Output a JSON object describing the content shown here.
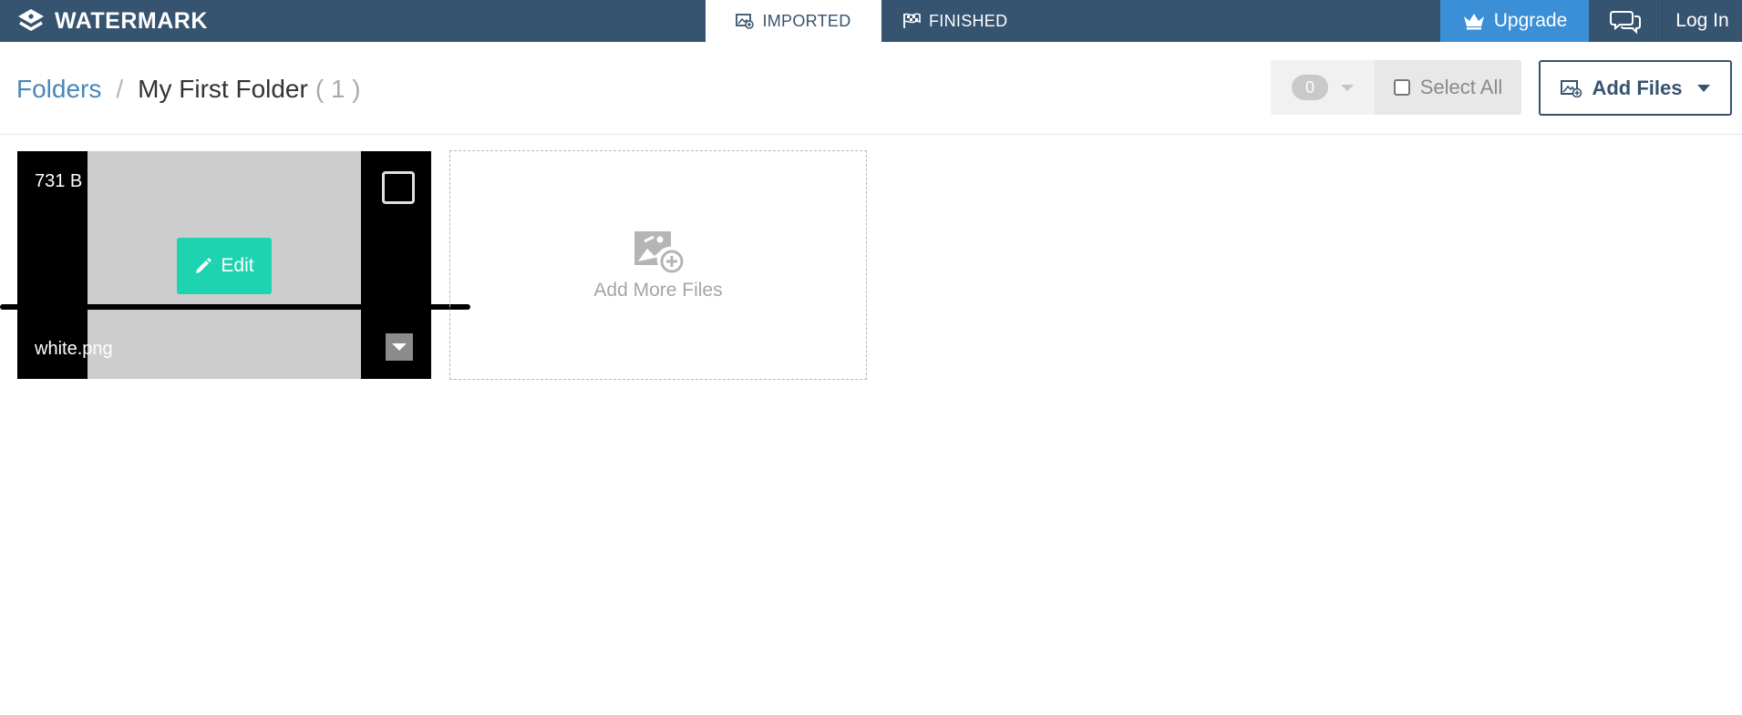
{
  "brand": {
    "name": "WATERMARK"
  },
  "nav": {
    "tabs": [
      {
        "label": "IMPORTED",
        "icon": "image-icon",
        "active": true
      },
      {
        "label": "FINISHED",
        "icon": "checkered-flag-icon",
        "active": false
      }
    ],
    "upgrade_label": "Upgrade",
    "upgrade_icon": "crown-icon",
    "chat_icon": "chat-bubbles-icon",
    "login_label": "Log In"
  },
  "breadcrumb": {
    "root": "Folders",
    "separator": "/",
    "current": "My First Folder",
    "count": "( 1 )"
  },
  "toolbar": {
    "selected_count": "0",
    "select_all_label": "Select All",
    "add_files_label": "Add Files"
  },
  "files": [
    {
      "size": "731 B",
      "name": "white.png",
      "action_label": "Edit"
    }
  ],
  "add_more": {
    "label": "Add More Files"
  },
  "colors": {
    "topbar": "#36536f",
    "upgrade": "#3a8fd6",
    "edit_button": "#1dd3b0",
    "link": "#4a86b8"
  }
}
